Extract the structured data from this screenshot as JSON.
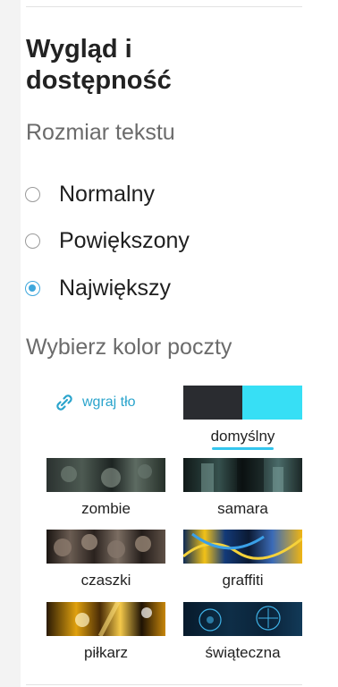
{
  "settings": {
    "section_title": "Wygląd i dostępność",
    "text_size": {
      "label": "Rozmiar tekstu",
      "options": [
        {
          "label": "Normalny",
          "checked": false
        },
        {
          "label": "Powiększony",
          "checked": false
        },
        {
          "label": "Największy",
          "checked": true
        }
      ]
    },
    "mail_color": {
      "label": "Wybierz kolor poczty",
      "upload_label": "wgraj tło",
      "themes": [
        {
          "name": "domyślny",
          "selected": true
        },
        {
          "name": "zombie",
          "selected": false
        },
        {
          "name": "samara",
          "selected": false
        },
        {
          "name": "czaszki",
          "selected": false
        },
        {
          "name": "graffiti",
          "selected": false
        },
        {
          "name": "piłkarz",
          "selected": false
        },
        {
          "name": "świąteczna",
          "selected": false
        }
      ]
    }
  },
  "colors": {
    "accent": "#3ea7dc",
    "link": "#2aa4cc",
    "underline": "#34c6ee",
    "default_theme_dark": "#2a2c30",
    "default_theme_light": "#37dff5"
  },
  "icons": {
    "upload": "link-icon"
  }
}
